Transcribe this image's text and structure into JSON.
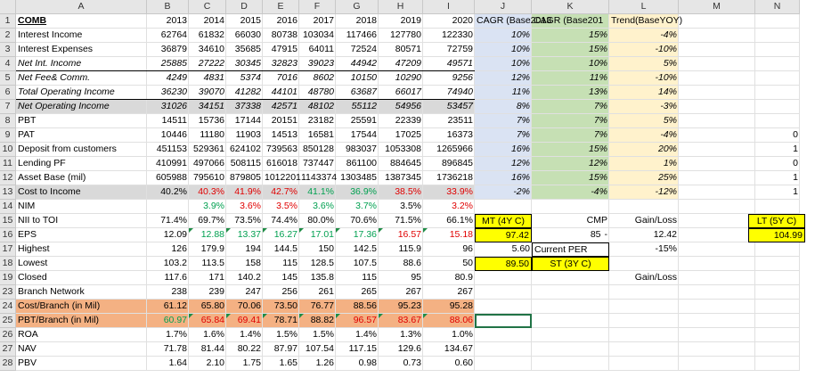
{
  "colors": {
    "blue": "#dae3f3",
    "green": "#c6e0b4",
    "yellow": "#fff2cc",
    "gray": "#d9d9d9",
    "orange": "#f4b183",
    "highlight": "#ffff00",
    "red": "#e00000",
    "green_text": "#00a050"
  },
  "columns": [
    "A",
    "B",
    "C",
    "D",
    "E",
    "F",
    "G",
    "H",
    "I",
    "J",
    "K",
    "L",
    "M",
    "N"
  ],
  "row_numbers": [
    "1",
    "2",
    "3",
    "4",
    "5",
    "6",
    "7",
    "8",
    "9",
    "10",
    "11",
    "12",
    "13",
    "14",
    "15",
    "16",
    "17",
    "18",
    "19",
    "23",
    "24",
    "25",
    "26",
    "27",
    "28"
  ],
  "header_row": {
    "label": "COMB",
    "years": [
      "2013",
      "2014",
      "2015",
      "2016",
      "2017",
      "2018",
      "2019",
      "2020"
    ],
    "j": "CAGR (Base2013",
    "k": "CAGR (Base201",
    "l": "Trend(BaseYOY)"
  },
  "rows": [
    {
      "label": "Interest Income",
      "vals": [
        "62764",
        "61832",
        "66030",
        "80738",
        "103034",
        "117466",
        "127780",
        "122330"
      ],
      "j": "10%",
      "k": "15%",
      "l": "-4%",
      "n": ""
    },
    {
      "label": "Interest Expenses",
      "vals": [
        "36879",
        "34610",
        "35685",
        "47915",
        "64011",
        "72524",
        "80571",
        "72759"
      ],
      "j": "10%",
      "k": "15%",
      "l": "-10%",
      "n": ""
    },
    {
      "label": "Net Int. Income",
      "vals": [
        "25885",
        "27222",
        "30345",
        "32823",
        "39023",
        "44942",
        "47209",
        "49571"
      ],
      "j": "10%",
      "k": "10%",
      "l": "5%",
      "n": ""
    },
    {
      "label": "Net Fee& Comm.",
      "vals": [
        "4249",
        "4831",
        "5374",
        "7016",
        "8602",
        "10150",
        "10290",
        "9256"
      ],
      "j": "12%",
      "k": "11%",
      "l": "-10%",
      "n": ""
    },
    {
      "label": "Total Operating Income",
      "vals": [
        "36230",
        "39070",
        "41282",
        "44101",
        "48780",
        "63687",
        "66017",
        "74940"
      ],
      "j": "11%",
      "k": "13%",
      "l": "14%",
      "n": ""
    },
    {
      "label": "Net Operating Income",
      "vals": [
        "31026",
        "34151",
        "37338",
        "42571",
        "48102",
        "55112",
        "54956",
        "53457"
      ],
      "j": "8%",
      "k": "7%",
      "l": "-3%",
      "n": ""
    },
    {
      "label": "PBT",
      "vals": [
        "14511",
        "15736",
        "17144",
        "20151",
        "23182",
        "25591",
        "22339",
        "23511"
      ],
      "j": "7%",
      "k": "7%",
      "l": "5%",
      "n": ""
    },
    {
      "label": "PAT",
      "vals": [
        "10446",
        "11180",
        "11903",
        "14513",
        "16581",
        "17544",
        "17025",
        "16373"
      ],
      "j": "7%",
      "k": "7%",
      "l": "-4%",
      "n": "0"
    },
    {
      "label": "Deposit from customers",
      "vals": [
        "451153",
        "529361",
        "624102",
        "739563",
        "850128",
        "983037",
        "1053308",
        "1265966"
      ],
      "j": "16%",
      "k": "15%",
      "l": "20%",
      "n": "1"
    },
    {
      "label": "Lending PF",
      "vals": [
        "410991",
        "497066",
        "508115",
        "616018",
        "737447",
        "861100",
        "884645",
        "896845"
      ],
      "j": "12%",
      "k": "12%",
      "l": "1%",
      "n": "0"
    },
    {
      "label": "Asset Base (mil)",
      "vals": [
        "605988",
        "795610",
        "879805",
        "1012201",
        "1143374",
        "1303485",
        "1387345",
        "1736218"
      ],
      "j": "16%",
      "k": "15%",
      "l": "25%",
      "n": "1"
    },
    {
      "label": "Cost to Income",
      "vals": [
        "40.2%",
        "40.3%",
        "41.9%",
        "42.7%",
        "41.1%",
        "36.9%",
        "38.5%",
        "33.9%"
      ],
      "j": "-2%",
      "k": "-4%",
      "l": "-12%",
      "n": "1"
    },
    {
      "label": "NIM",
      "vals": [
        "",
        "3.9%",
        "3.6%",
        "3.5%",
        "3.6%",
        "3.7%",
        "3.5%",
        "3.2%"
      ],
      "j": "",
      "k": "",
      "l": "",
      "n": ""
    },
    {
      "label": "NII to TOI",
      "vals": [
        "71.4%",
        "69.7%",
        "73.5%",
        "74.4%",
        "80.0%",
        "70.6%",
        "71.5%",
        "66.1%"
      ],
      "j": "MT (4Y C)",
      "k": "CMP",
      "l": "Gain/Loss",
      "n": "LT (5Y C)"
    },
    {
      "label": "EPS",
      "vals": [
        "12.09",
        "12.88",
        "13.37",
        "16.27",
        "17.01",
        "17.36",
        "16.57",
        "15.18"
      ],
      "j": "97.42",
      "k": "85",
      "l": "12.42",
      "n": "104.99"
    },
    {
      "label": "Highest",
      "vals": [
        "126",
        "179.9",
        "194",
        "144.5",
        "150",
        "142.5",
        "115.9",
        "96"
      ],
      "j": "5.60",
      "k": "Current PER",
      "l": "-15%",
      "n": ""
    },
    {
      "label": "Lowest",
      "vals": [
        "103.2",
        "113.5",
        "158",
        "115",
        "128.5",
        "107.5",
        "88.6",
        "50"
      ],
      "j": "89.50",
      "k": "ST (3Y C)",
      "l": "",
      "n": ""
    },
    {
      "label": "Closed",
      "vals": [
        "117.6",
        "171",
        "140.2",
        "145",
        "135.8",
        "115",
        "95",
        "80.9"
      ],
      "j": "",
      "k": "",
      "l": "Gain/Loss",
      "n": ""
    },
    {
      "label": "Branch Network",
      "vals": [
        "238",
        "239",
        "247",
        "256",
        "261",
        "265",
        "267",
        "267"
      ],
      "j": "",
      "k": "",
      "l": "",
      "n": ""
    },
    {
      "label": "Cost/Branch (in Mil)",
      "vals": [
        "61.12",
        "65.80",
        "70.06",
        "73.50",
        "76.77",
        "88.56",
        "95.23",
        "95.28"
      ],
      "j": "",
      "k": "",
      "l": "",
      "n": ""
    },
    {
      "label": "PBT/Branch (in Mil)",
      "vals": [
        "60.97",
        "65.84",
        "69.41",
        "78.71",
        "88.82",
        "96.57",
        "83.67",
        "88.06"
      ],
      "j": "",
      "k": "",
      "l": "",
      "n": ""
    },
    {
      "label": "ROA",
      "vals": [
        "1.7%",
        "1.6%",
        "1.4%",
        "1.5%",
        "1.5%",
        "1.4%",
        "1.3%",
        "1.0%"
      ],
      "j": "",
      "k": "",
      "l": "",
      "n": ""
    },
    {
      "label": "NAV",
      "vals": [
        "71.78",
        "81.44",
        "80.22",
        "87.97",
        "107.54",
        "117.15",
        "129.6",
        "134.67"
      ],
      "j": "",
      "k": "",
      "l": "",
      "n": ""
    },
    {
      "label": "PBV",
      "vals": [
        "1.64",
        "2.10",
        "1.75",
        "1.65",
        "1.26",
        "0.98",
        "0.73",
        "0.60"
      ],
      "j": "",
      "k": "",
      "l": "",
      "n": ""
    }
  ],
  "dash": "-"
}
